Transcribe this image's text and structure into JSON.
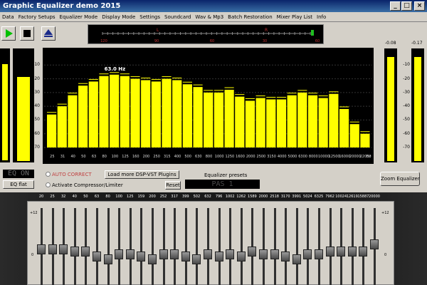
{
  "window": {
    "title": "Graphic Equalizer demo 2015"
  },
  "menu": [
    "Data",
    "Factory Setups",
    "Equalizer Mode",
    "Display Mode",
    "Settings",
    "Soundcard",
    "Wav & Mp3",
    "Batch Restoration",
    "Mixer Play List",
    "Info"
  ],
  "transport": {
    "play_icon": "play-icon",
    "stop_icon": "stop-icon",
    "eject_icon": "eject-icon"
  },
  "balance_meter": {
    "top_labels": [
      "L",
      "R"
    ],
    "bottom_labels": [
      "120",
      "90",
      "60",
      "30",
      "60"
    ]
  },
  "side_meters": {
    "right_values": [
      "-0.08",
      "-0.17"
    ]
  },
  "spectrum": {
    "peak_label": "63.0 Hz",
    "y_ticks": [
      "-10",
      "-20",
      "-30",
      "-40",
      "-50",
      "-60",
      "-70"
    ],
    "frequencies": [
      "25",
      "31",
      "40",
      "50",
      "63",
      "80",
      "100",
      "125",
      "160",
      "200",
      "250",
      "315",
      "400",
      "500",
      "630",
      "800",
      "1000",
      "1250",
      "1600",
      "2000",
      "2500",
      "3150",
      "4000",
      "5000",
      "6300",
      "8000",
      "10000",
      "12500",
      "16000",
      "20000",
      "22050"
    ],
    "levels_db": [
      -46,
      -40,
      -32,
      -25,
      -22,
      -18,
      -17,
      -18,
      -20,
      -21,
      -22,
      -20,
      -21,
      -24,
      -26,
      -30,
      -30,
      -28,
      -33,
      -36,
      -34,
      -35,
      -35,
      -32,
      -30,
      -32,
      -34,
      -31,
      -42,
      -53,
      -60
    ],
    "freq_unit": "Hz"
  },
  "controls": {
    "eq_status": "EQ ON",
    "auto_correct": "AUTO CORRECT",
    "load_plugins": "Load more DSP-VST Plugins",
    "presets_label": "Equalizer presets",
    "preset_value": "PAS 1",
    "eq_flat": "EQ flat",
    "compressor": "Activate Compressor/Limiter",
    "reset": "Reset",
    "zoom": "Zoom Equalizer"
  },
  "sliders": {
    "bands": [
      "20",
      "25",
      "32",
      "40",
      "50",
      "63",
      "80",
      "100",
      "125",
      "159",
      "200",
      "252",
      "317",
      "399",
      "502",
      "632",
      "796",
      "1002",
      "1262",
      "1589",
      "2000",
      "2518",
      "3170",
      "3991",
      "5024",
      "6325",
      "7962",
      "10024",
      "12619",
      "15887",
      "20000"
    ],
    "gain_db": [
      1,
      1,
      1,
      0,
      0,
      -2,
      -3,
      -1,
      -1,
      -2,
      -3,
      -1,
      -1,
      -2,
      -3,
      -1,
      -2,
      -1,
      -2,
      0,
      -1,
      -1,
      -2,
      -3,
      -1,
      -1,
      0,
      0,
      0,
      0,
      3
    ],
    "scale_left": [
      "+12",
      "0"
    ],
    "scale_right": [
      "+12",
      "0"
    ]
  }
}
